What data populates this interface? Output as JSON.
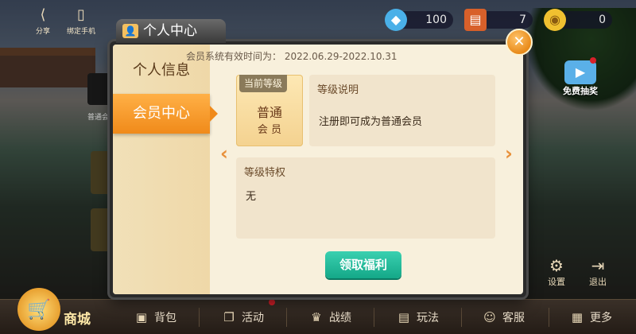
{
  "topbar": {
    "share_label": "分享",
    "bind_phone_label": "绑定手机",
    "resources": [
      {
        "name": "diamond",
        "value": "100",
        "icon": "diamond-icon"
      },
      {
        "name": "ticket",
        "value": "7",
        "icon": "ticket-icon"
      },
      {
        "name": "gold",
        "value": "0",
        "icon": "coin-icon"
      }
    ]
  },
  "background": {
    "avatar_label": "普通会",
    "free_draw_label": "免费抽奖",
    "settings_label": "设置",
    "exit_label": "退出"
  },
  "bottombar": {
    "shop_label": "商城",
    "items": [
      {
        "label": "背包",
        "icon": "backpack-icon"
      },
      {
        "label": "活动",
        "icon": "gift-icon"
      },
      {
        "label": "战绩",
        "icon": "trophy-icon"
      },
      {
        "label": "玩法",
        "icon": "document-icon"
      },
      {
        "label": "客服",
        "icon": "support-icon"
      },
      {
        "label": "更多",
        "icon": "grid-icon"
      }
    ]
  },
  "modal": {
    "title": "个人中心",
    "tabs": [
      {
        "label": "个人信息",
        "active": false
      },
      {
        "label": "会员中心",
        "active": true
      }
    ],
    "validity_text": "会员系统有效时间为：  2022.06.29-2022.10.31",
    "current_level_tag": "当前等级",
    "level_name": "普通",
    "level_sub": "会 员",
    "level_desc_header": "等级说明",
    "level_desc_body": "注册即可成为普通会员",
    "privileges_header": "等级特权",
    "privileges_body": "无",
    "claim_button": "领取福利",
    "prev_arrow": "‹",
    "next_arrow": "›",
    "close_symbol": "✕"
  },
  "colors": {
    "accent_orange": "#f08a1a",
    "claim_green": "#14a888",
    "panel_bg": "#f1e4cc"
  }
}
